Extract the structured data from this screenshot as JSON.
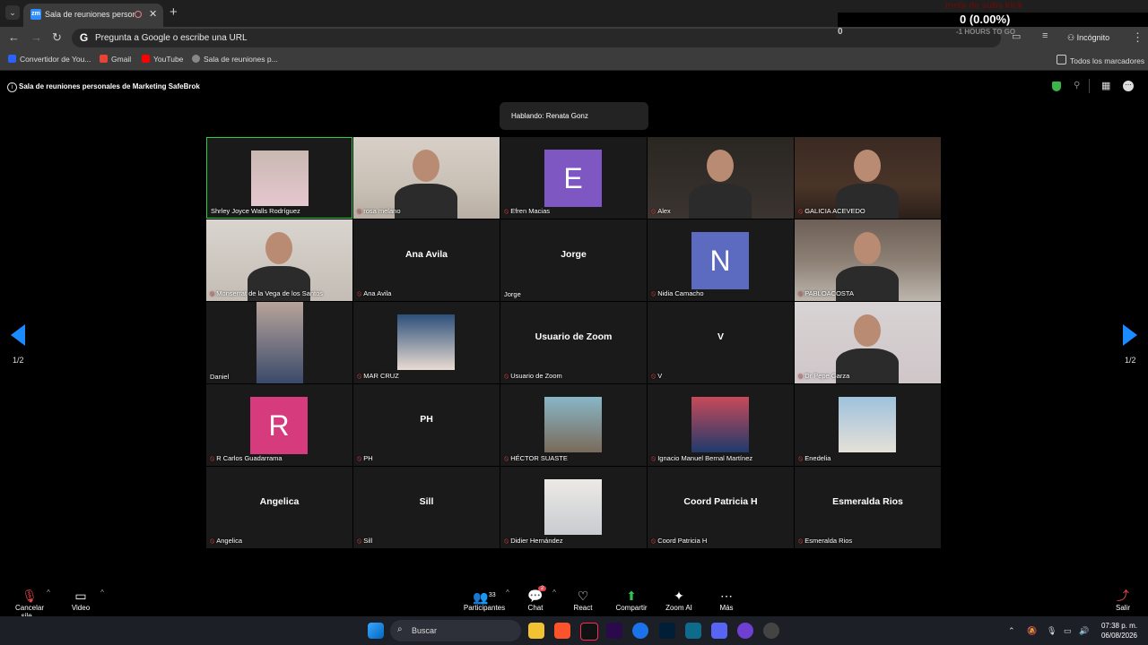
{
  "browser": {
    "tab_title": "Sala de reuniones personal...",
    "tab_favicon_text": "zm",
    "omnibox_placeholder": "Pregunta a Google o escribe una URL",
    "incognito_label": "Incógnito",
    "bookmarks": [
      "Convertidor de You...",
      "Gmail",
      "YouTube",
      "Sala de reuniones p..."
    ],
    "all_bookmarks": "Todos los marcadores"
  },
  "overlay": {
    "title": "meta de subs kick",
    "value": "0 (0.00%)",
    "left": "0",
    "hours": "-1 HOURS TO GO"
  },
  "meeting": {
    "title": "Sala de reuniones personales de Marketing SafeBrok",
    "speaking": "Hablando: Renata Gonz",
    "pager_left": "1/2",
    "pager_right": "1/2"
  },
  "participants": [
    {
      "label": "Shrley Joyce Walls Rodríguez",
      "type": "thumb",
      "muted": false
    },
    {
      "label": "rosa melano",
      "type": "video",
      "muted": true
    },
    {
      "label": "Efren Macias",
      "type": "avatar",
      "initial": "E",
      "color": "#7e57c2",
      "muted": true
    },
    {
      "label": "Alex",
      "type": "video",
      "muted": true
    },
    {
      "label": "GALICIA ACEVEDO",
      "type": "video",
      "muted": true
    },
    {
      "label": "Monserrat de la Vega de los Santos",
      "type": "video",
      "muted": true
    },
    {
      "label": "Ana Avila",
      "type": "name",
      "big": "Ana Avila",
      "muted": true
    },
    {
      "label": "Jorge",
      "type": "name",
      "big": "Jorge",
      "muted": false
    },
    {
      "label": "Nidia Camacho",
      "type": "avatar",
      "initial": "N",
      "color": "#5c6bc0",
      "muted": true
    },
    {
      "label": "PABLOACOSTA",
      "type": "video",
      "muted": true
    },
    {
      "label": "Daniel",
      "type": "thumb",
      "muted": false
    },
    {
      "label": "MAR CRUZ",
      "type": "thumb",
      "muted": true
    },
    {
      "label": "Usuario de Zoom",
      "type": "name",
      "big": "Usuario de Zoom",
      "muted": true
    },
    {
      "label": "V",
      "type": "name",
      "big": "V",
      "muted": true
    },
    {
      "label": "Dr Pepe Garza",
      "type": "video",
      "muted": true
    },
    {
      "label": "R Carlos Guadarrama",
      "type": "avatar",
      "initial": "R",
      "color": "#d63b7d",
      "muted": true
    },
    {
      "label": "PH",
      "type": "name",
      "big": "PH",
      "muted": true
    },
    {
      "label": "HÉCTOR SUASTE",
      "type": "thumb",
      "muted": true
    },
    {
      "label": "Ignacio Manuel Bernal Martínez",
      "type": "thumb",
      "muted": true
    },
    {
      "label": "Enedelia",
      "type": "thumb",
      "muted": true
    },
    {
      "label": "Angelica",
      "type": "name",
      "big": "Angelica",
      "muted": true
    },
    {
      "label": "Sill",
      "type": "name",
      "big": "Sill",
      "muted": true
    },
    {
      "label": "Didier Hernández",
      "type": "thumb",
      "muted": true
    },
    {
      "label": "Coord Patricia H",
      "type": "name",
      "big": "Coord Patricia H",
      "muted": true
    },
    {
      "label": "Esmeralda Rios",
      "type": "name",
      "big": "Esmeralda Rios",
      "muted": true
    }
  ],
  "toolbar": {
    "mute": "Cancelar sile...",
    "video": "Video",
    "participants": "Participantes",
    "participants_count": "33",
    "chat": "Chat",
    "chat_badge": "2",
    "react": "React",
    "share": "Compartir",
    "zoom_ai": "Zoom AI",
    "more": "Más",
    "leave": "Salir"
  },
  "taskbar": {
    "search": "Buscar",
    "time": "07:38 p. m.",
    "date": "06/08/2026"
  }
}
